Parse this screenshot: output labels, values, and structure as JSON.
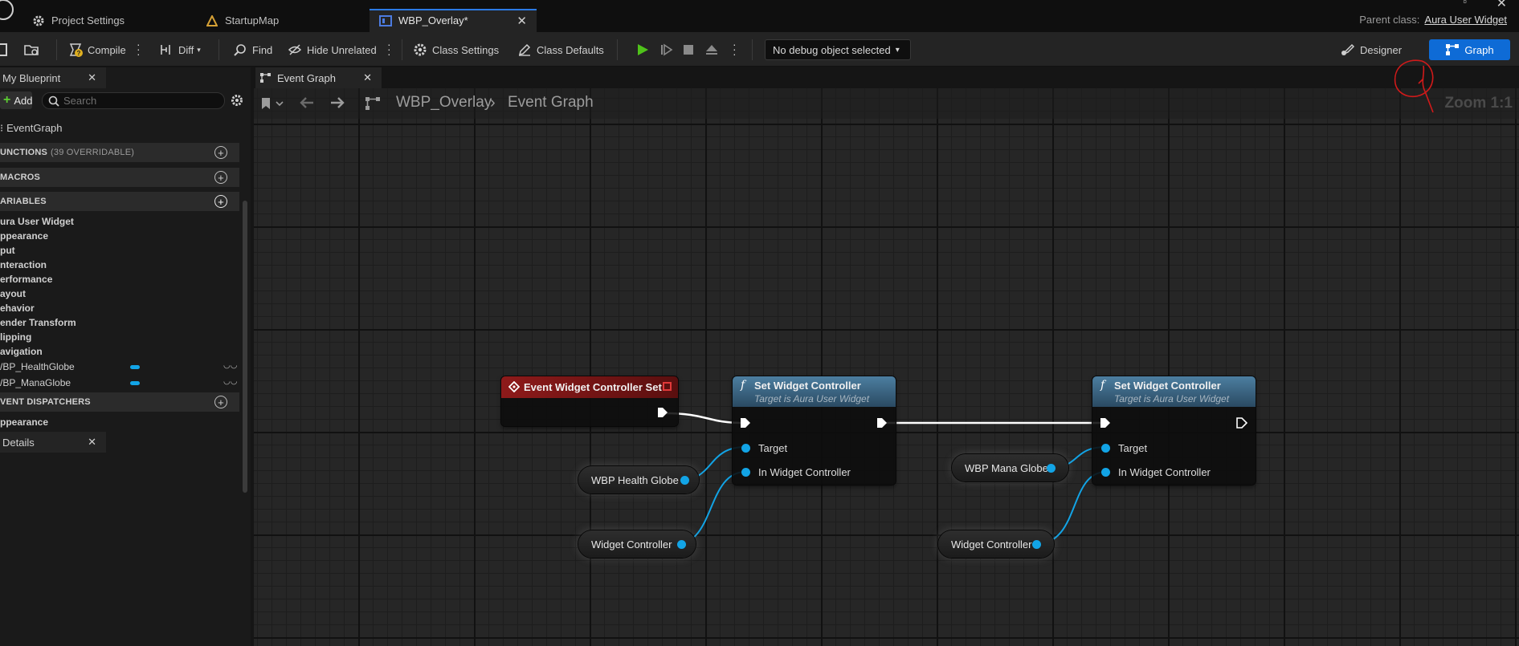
{
  "tabs": [
    {
      "label": "Project Settings",
      "icon": "gear-icon"
    },
    {
      "label": "StartupMap",
      "icon": "level-icon"
    },
    {
      "label": "WBP_Overlay*",
      "icon": "widget-blueprint-icon"
    }
  ],
  "parent_class": {
    "label": "Parent class:",
    "value": "Aura User Widget"
  },
  "toolbar": {
    "compile": "Compile",
    "diff": "Diff",
    "find": "Find",
    "hide_unrelated": "Hide Unrelated",
    "class_settings": "Class Settings",
    "class_defaults": "Class Defaults",
    "debug_object": "No debug object selected",
    "designer": "Designer",
    "graph": "Graph"
  },
  "my_blueprint": {
    "tab_label": "My Blueprint",
    "add_label": "Add",
    "search_placeholder": "Search",
    "event_graph": "EventGraph",
    "functions": {
      "label": "UNCTIONS",
      "count": "(39 OVERRIDABLE)"
    },
    "macros": "MACROS",
    "variables": "ARIABLES",
    "variable_items": [
      "ura User Widget",
      "ppearance",
      "put",
      "nteraction",
      "erformance",
      "ayout",
      "ehavior",
      "ender Transform",
      "lipping",
      "avigation",
      "/BP_HealthGlobe",
      "/BP_ManaGlobe"
    ],
    "event_dispatchers": "VENT DISPATCHERS",
    "dispatcher_items": [
      "ppearance"
    ]
  },
  "details": {
    "tab_label": "Details"
  },
  "graph": {
    "tab_label": "Event Graph",
    "breadcrumb": [
      "WBP_Overlay",
      "Event Graph"
    ],
    "zoom": "Zoom 1:1",
    "nodes": {
      "event": {
        "title": "Event Widget Controller Set"
      },
      "set1": {
        "title": "Set Widget Controller",
        "subtitle": "Target is Aura User Widget",
        "pin_target": "Target",
        "pin_controller": "In Widget Controller"
      },
      "set2": {
        "title": "Set Widget Controller",
        "subtitle": "Target is Aura User Widget",
        "pin_target": "Target",
        "pin_controller": "In Widget Controller"
      },
      "var_health": "WBP Health Globe",
      "var_controller1": "Widget Controller",
      "var_mana": "WBP Mana Globe",
      "var_controller2": "Widget Controller"
    }
  },
  "colors": {
    "accent": "#0e6bd6",
    "event_header": "#7a1414",
    "function_header": "#3f6d8c",
    "object_pin": "#12a4e6",
    "annotation": "#d11a1a"
  }
}
